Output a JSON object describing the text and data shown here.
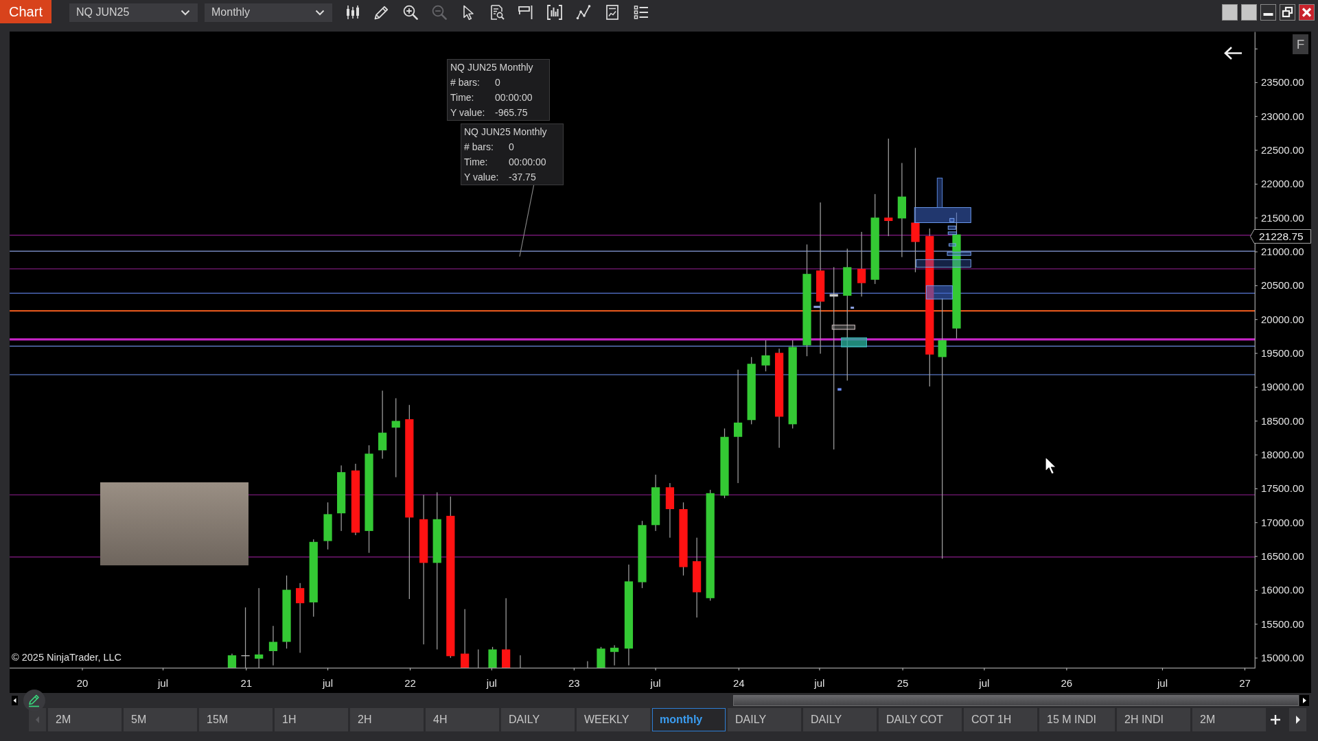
{
  "toolbar": {
    "app_label": "Chart",
    "instrument": "NQ JUN25",
    "interval": "Monthly",
    "tools": [
      {
        "kind": "candles",
        "disabled": false
      },
      {
        "kind": "pencil",
        "disabled": false
      },
      {
        "kind": "zoomin",
        "disabled": false
      },
      {
        "kind": "zoomout",
        "disabled": true
      },
      {
        "kind": "pointer",
        "disabled": false
      },
      {
        "kind": "databox",
        "disabled": false
      },
      {
        "kind": "signboard",
        "disabled": false
      },
      {
        "kind": "indicators",
        "disabled": false
      },
      {
        "kind": "nodes",
        "disabled": false
      },
      {
        "kind": "report",
        "disabled": false
      },
      {
        "kind": "list",
        "disabled": false
      }
    ]
  },
  "chart": {
    "tooltips": [
      {
        "title": "NQ JUN25 Monthly",
        "rows": [
          {
            "label": "# bars:",
            "value": "0"
          },
          {
            "label": "Time:",
            "value": "00:00:00"
          },
          {
            "label": "Y value:",
            "value": "-965.75"
          }
        ]
      },
      {
        "title": "NQ JUN25 Monthly",
        "rows": [
          {
            "label": "# bars:",
            "value": "0"
          },
          {
            "label": "Time:",
            "value": "00:00:00"
          },
          {
            "label": "Y value:",
            "value": "-37.75"
          }
        ]
      }
    ],
    "f_button": "F",
    "last_price": "21228.75",
    "price_axis": [
      "23500.00",
      "23000.00",
      "22500.00",
      "22000.00",
      "21500.00",
      "21000.00",
      "20500.00",
      "20000.00",
      "19500.00",
      "19000.00",
      "18500.00",
      "18000.00",
      "17500.00",
      "17000.00",
      "16500.00",
      "16000.00",
      "15500.00",
      "15000.00"
    ],
    "time_axis": [
      "20",
      "jul",
      "21",
      "jul",
      "22",
      "jul",
      "23",
      "jul",
      "24",
      "jul",
      "25",
      "jul",
      "26",
      "jul",
      "27"
    ],
    "copyright": "© 2025 NinjaTrader, LLC"
  },
  "tabs": [
    {
      "label": "2M",
      "selected": false
    },
    {
      "label": "5M",
      "selected": false
    },
    {
      "label": "15M",
      "selected": false
    },
    {
      "label": "1H",
      "selected": false
    },
    {
      "label": "2H",
      "selected": false
    },
    {
      "label": "4H",
      "selected": false
    },
    {
      "label": "DAILY",
      "selected": false
    },
    {
      "label": "WEEKLY",
      "selected": false
    },
    {
      "label": "monthly",
      "selected": true
    },
    {
      "label": "DAILY",
      "selected": false
    },
    {
      "label": "DAILY",
      "selected": false
    },
    {
      "label": "DAILY COT",
      "selected": false
    },
    {
      "label": "COT 1H",
      "selected": false
    },
    {
      "label": "15 M INDI",
      "selected": false
    },
    {
      "label": "2H INDI",
      "selected": false
    },
    {
      "label": "2M",
      "selected": false
    }
  ]
}
